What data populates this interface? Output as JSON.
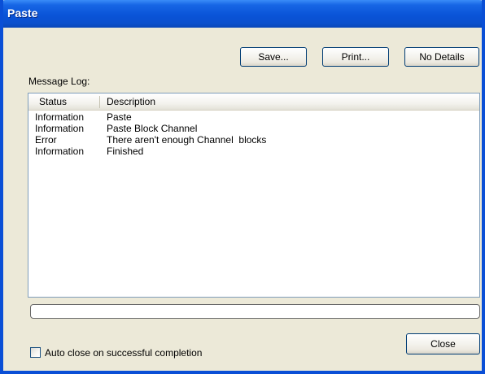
{
  "window": {
    "title": "Paste"
  },
  "toolbar": {
    "save_label": "Save...",
    "print_label": "Print...",
    "no_details_label": "No Details"
  },
  "log": {
    "label": "Message Log:",
    "columns": {
      "status": "Status",
      "description": "Description"
    },
    "rows": [
      {
        "status": "Information",
        "description": "Paste"
      },
      {
        "status": "Information",
        "description": "Paste Block Channel"
      },
      {
        "status": "Error",
        "description": "There aren't enough Channel  blocks"
      },
      {
        "status": "Information",
        "description": "Finished"
      }
    ]
  },
  "footer": {
    "auto_close_label": "Auto close on successful completion",
    "auto_close_checked": false,
    "close_label": "Close"
  },
  "colors": {
    "titlebar": "#0a54d8",
    "dialog_bg": "#ece9d8",
    "button_border": "#003c74",
    "list_border": "#7f9db9"
  }
}
